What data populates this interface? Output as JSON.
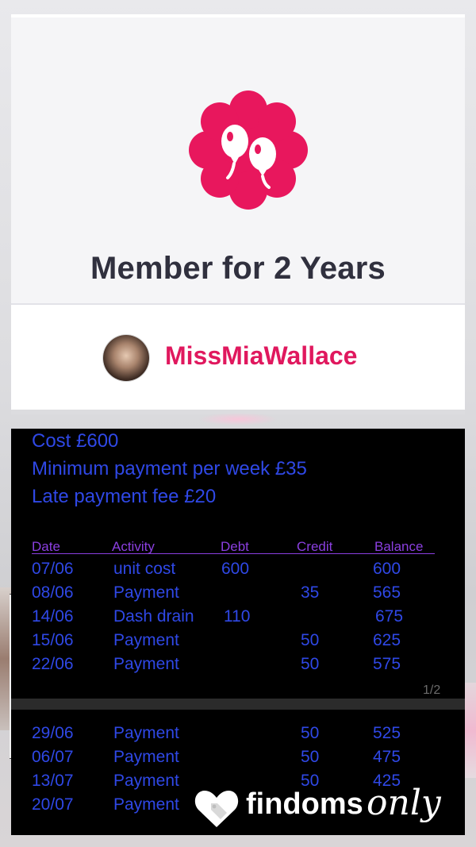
{
  "membership": {
    "title": "Member for 2 Years"
  },
  "profile": {
    "username": "MissMiaWallace"
  },
  "ledger": {
    "summary": [
      "Cost £600",
      "Minimum payment per week £35",
      "Late payment fee £20"
    ],
    "headers": {
      "date": "Date",
      "activity": "Activity",
      "debt": "Debt",
      "credit": "Credit",
      "balance": "Balance"
    },
    "rows": [
      {
        "date": "07/06",
        "activity": "unit cost",
        "debt": "600",
        "credit": "",
        "balance": "600"
      },
      {
        "date": "08/06",
        "activity": "Payment",
        "debt": "",
        "credit": "35",
        "balance": "565"
      },
      {
        "date": "14/06",
        "activity": "Dash drain",
        "debt": "110",
        "credit": "",
        "balance": "675"
      },
      {
        "date": "15/06",
        "activity": "Payment",
        "debt": "",
        "credit": "50",
        "balance": "625"
      },
      {
        "date": "22/06",
        "activity": "Payment",
        "debt": "",
        "credit": "50",
        "balance": "575"
      },
      {
        "date": "29/06",
        "activity": "Payment",
        "debt": "",
        "credit": "50",
        "balance": "525"
      },
      {
        "date": "06/07",
        "activity": "Payment",
        "debt": "",
        "credit": "50",
        "balance": "475"
      },
      {
        "date": "13/07",
        "activity": "Payment",
        "debt": "",
        "credit": "50",
        "balance": "425"
      },
      {
        "date": "20/07",
        "activity": "Payment",
        "debt": "",
        "credit": "",
        "balance": ""
      }
    ],
    "page_indicator": "1/2"
  },
  "watermark": {
    "brand_bold": "findoms",
    "brand_script": "only"
  },
  "colors": {
    "accent_pink": "#e0185e",
    "ledger_text": "#2f48e6",
    "ledger_header": "#8b3fe0",
    "title_text": "#30303e"
  },
  "icons": {
    "badge": "balloons-badge-icon",
    "watermark": "heart-tag-icon"
  }
}
